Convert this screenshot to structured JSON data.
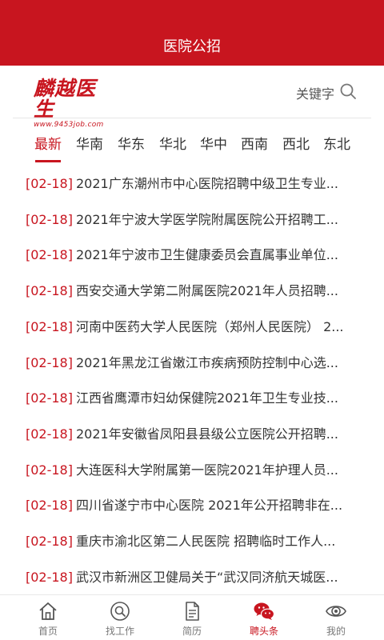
{
  "header": {
    "title": "医院公招"
  },
  "brand": {
    "logo_text": "麟越医生",
    "logo_url": "www.9453job.com"
  },
  "search": {
    "keyword_label": "关键字",
    "icon": "search-icon"
  },
  "tabs": [
    {
      "label": "最新",
      "active": true
    },
    {
      "label": "华南"
    },
    {
      "label": "华东"
    },
    {
      "label": "华北"
    },
    {
      "label": "华中"
    },
    {
      "label": "西南"
    },
    {
      "label": "西北"
    },
    {
      "label": "东北"
    }
  ],
  "articles": [
    {
      "date": "[02-18]",
      "title": "2021广东潮州市中心医院招聘中级卫生专业..."
    },
    {
      "date": "[02-18]",
      "title": "2021年宁波大学医学院附属医院公开招聘工..."
    },
    {
      "date": "[02-18]",
      "title": "2021年宁波市卫生健康委员会直属事业单位..."
    },
    {
      "date": "[02-18]",
      "title": "西安交通大学第二附属医院2021年人员招聘..."
    },
    {
      "date": "[02-18]",
      "title": "河南中医药大学人民医院（郑州人民医院） 2..."
    },
    {
      "date": "[02-18]",
      "title": "2021年黑龙江省嫩江市疾病预防控制中心选..."
    },
    {
      "date": "[02-18]",
      "title": "江西省鹰潭市妇幼保健院2021年卫生专业技..."
    },
    {
      "date": "[02-18]",
      "title": "2021年安徽省凤阳县县级公立医院公开招聘..."
    },
    {
      "date": "[02-18]",
      "title": "大连医科大学附属第一医院2021年护理人员..."
    },
    {
      "date": "[02-18]",
      "title": "四川省遂宁市中心医院 2021年公开招聘非在..."
    },
    {
      "date": "[02-18]",
      "title": "重庆市渝北区第二人民医院 招聘临时工作人..."
    },
    {
      "date": "[02-18]",
      "title": "武汉市新洲区卫健局关于“武汉同济航天城医..."
    }
  ],
  "bottom_nav": [
    {
      "label": "首页",
      "icon": "home-icon"
    },
    {
      "label": "找工作",
      "icon": "find-job-icon"
    },
    {
      "label": "简历",
      "icon": "resume-icon"
    },
    {
      "label": "聘头条",
      "icon": "wechat-icon",
      "active": true
    },
    {
      "label": "我的",
      "icon": "eye-icon"
    }
  ],
  "colors": {
    "brand_red": "#c8151f",
    "text": "#333333",
    "muted": "#777777"
  }
}
